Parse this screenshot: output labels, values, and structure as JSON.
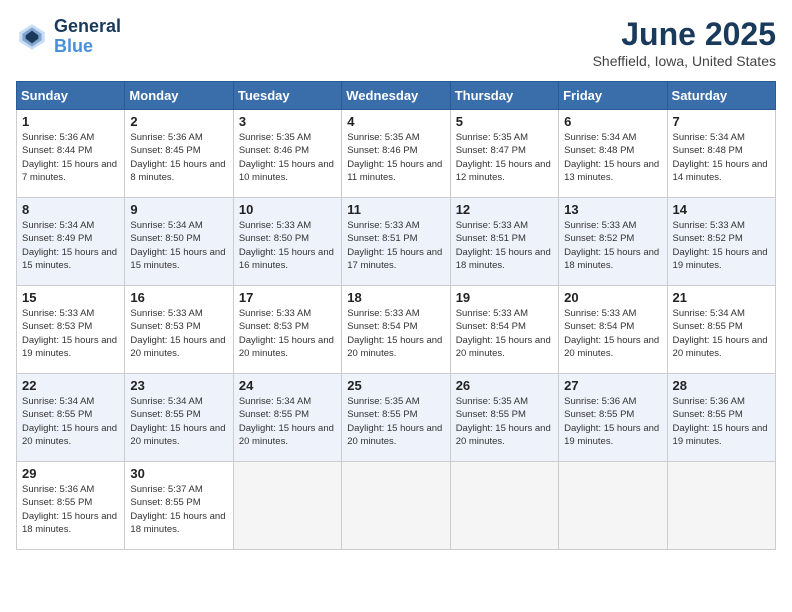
{
  "header": {
    "logo_line1": "General",
    "logo_line2": "Blue",
    "month_year": "June 2025",
    "location": "Sheffield, Iowa, United States"
  },
  "days_of_week": [
    "Sunday",
    "Monday",
    "Tuesday",
    "Wednesday",
    "Thursday",
    "Friday",
    "Saturday"
  ],
  "weeks": [
    [
      {
        "day": 1,
        "sunrise": "5:36 AM",
        "sunset": "8:44 PM",
        "daylight": "15 hours and 7 minutes."
      },
      {
        "day": 2,
        "sunrise": "5:36 AM",
        "sunset": "8:45 PM",
        "daylight": "15 hours and 8 minutes."
      },
      {
        "day": 3,
        "sunrise": "5:35 AM",
        "sunset": "8:46 PM",
        "daylight": "15 hours and 10 minutes."
      },
      {
        "day": 4,
        "sunrise": "5:35 AM",
        "sunset": "8:46 PM",
        "daylight": "15 hours and 11 minutes."
      },
      {
        "day": 5,
        "sunrise": "5:35 AM",
        "sunset": "8:47 PM",
        "daylight": "15 hours and 12 minutes."
      },
      {
        "day": 6,
        "sunrise": "5:34 AM",
        "sunset": "8:48 PM",
        "daylight": "15 hours and 13 minutes."
      },
      {
        "day": 7,
        "sunrise": "5:34 AM",
        "sunset": "8:48 PM",
        "daylight": "15 hours and 14 minutes."
      }
    ],
    [
      {
        "day": 8,
        "sunrise": "5:34 AM",
        "sunset": "8:49 PM",
        "daylight": "15 hours and 15 minutes."
      },
      {
        "day": 9,
        "sunrise": "5:34 AM",
        "sunset": "8:50 PM",
        "daylight": "15 hours and 15 minutes."
      },
      {
        "day": 10,
        "sunrise": "5:33 AM",
        "sunset": "8:50 PM",
        "daylight": "15 hours and 16 minutes."
      },
      {
        "day": 11,
        "sunrise": "5:33 AM",
        "sunset": "8:51 PM",
        "daylight": "15 hours and 17 minutes."
      },
      {
        "day": 12,
        "sunrise": "5:33 AM",
        "sunset": "8:51 PM",
        "daylight": "15 hours and 18 minutes."
      },
      {
        "day": 13,
        "sunrise": "5:33 AM",
        "sunset": "8:52 PM",
        "daylight": "15 hours and 18 minutes."
      },
      {
        "day": 14,
        "sunrise": "5:33 AM",
        "sunset": "8:52 PM",
        "daylight": "15 hours and 19 minutes."
      }
    ],
    [
      {
        "day": 15,
        "sunrise": "5:33 AM",
        "sunset": "8:53 PM",
        "daylight": "15 hours and 19 minutes."
      },
      {
        "day": 16,
        "sunrise": "5:33 AM",
        "sunset": "8:53 PM",
        "daylight": "15 hours and 20 minutes."
      },
      {
        "day": 17,
        "sunrise": "5:33 AM",
        "sunset": "8:53 PM",
        "daylight": "15 hours and 20 minutes."
      },
      {
        "day": 18,
        "sunrise": "5:33 AM",
        "sunset": "8:54 PM",
        "daylight": "15 hours and 20 minutes."
      },
      {
        "day": 19,
        "sunrise": "5:33 AM",
        "sunset": "8:54 PM",
        "daylight": "15 hours and 20 minutes."
      },
      {
        "day": 20,
        "sunrise": "5:33 AM",
        "sunset": "8:54 PM",
        "daylight": "15 hours and 20 minutes."
      },
      {
        "day": 21,
        "sunrise": "5:34 AM",
        "sunset": "8:55 PM",
        "daylight": "15 hours and 20 minutes."
      }
    ],
    [
      {
        "day": 22,
        "sunrise": "5:34 AM",
        "sunset": "8:55 PM",
        "daylight": "15 hours and 20 minutes."
      },
      {
        "day": 23,
        "sunrise": "5:34 AM",
        "sunset": "8:55 PM",
        "daylight": "15 hours and 20 minutes."
      },
      {
        "day": 24,
        "sunrise": "5:34 AM",
        "sunset": "8:55 PM",
        "daylight": "15 hours and 20 minutes."
      },
      {
        "day": 25,
        "sunrise": "5:35 AM",
        "sunset": "8:55 PM",
        "daylight": "15 hours and 20 minutes."
      },
      {
        "day": 26,
        "sunrise": "5:35 AM",
        "sunset": "8:55 PM",
        "daylight": "15 hours and 20 minutes."
      },
      {
        "day": 27,
        "sunrise": "5:36 AM",
        "sunset": "8:55 PM",
        "daylight": "15 hours and 19 minutes."
      },
      {
        "day": 28,
        "sunrise": "5:36 AM",
        "sunset": "8:55 PM",
        "daylight": "15 hours and 19 minutes."
      }
    ],
    [
      {
        "day": 29,
        "sunrise": "5:36 AM",
        "sunset": "8:55 PM",
        "daylight": "15 hours and 18 minutes."
      },
      {
        "day": 30,
        "sunrise": "5:37 AM",
        "sunset": "8:55 PM",
        "daylight": "15 hours and 18 minutes."
      },
      null,
      null,
      null,
      null,
      null
    ]
  ]
}
